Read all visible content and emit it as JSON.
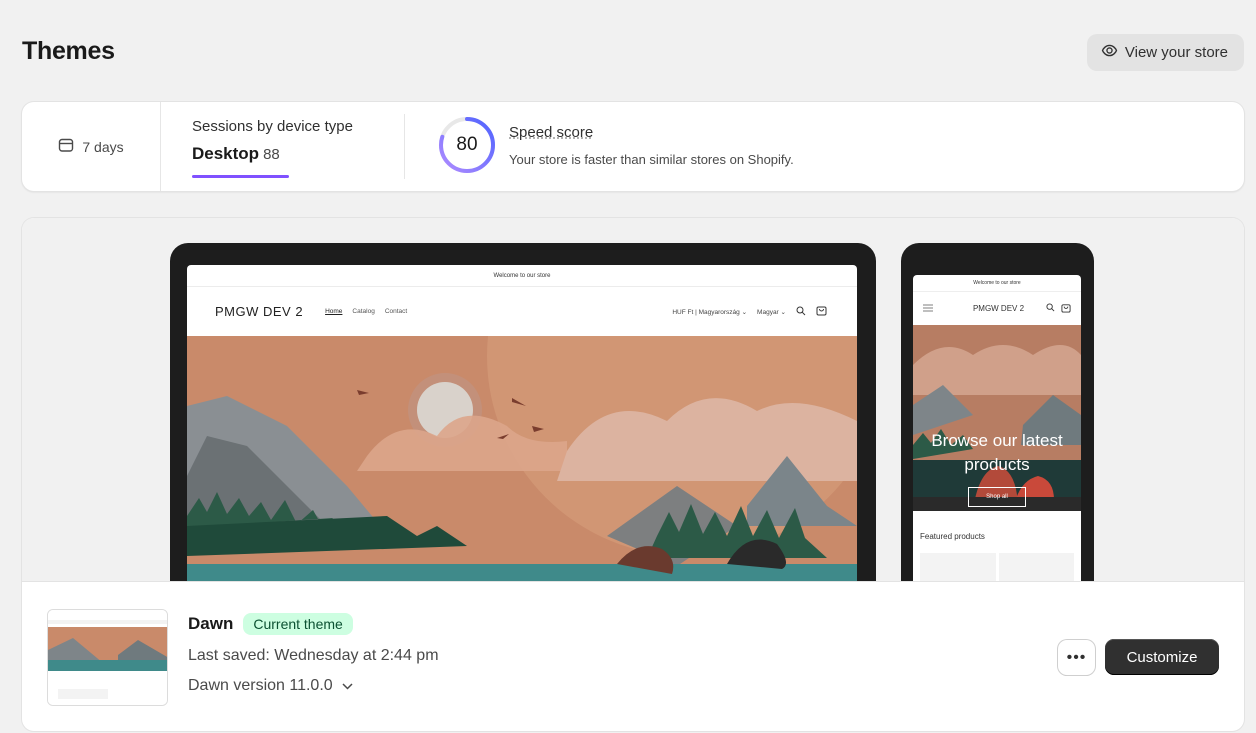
{
  "page": {
    "title": "Themes"
  },
  "header": {
    "view_store_label": "View your store"
  },
  "stats": {
    "period_label": "7 days",
    "sessions_label": "Sessions by device type",
    "device_label": "Desktop",
    "device_value": "88",
    "speed_score": "80",
    "speed_score_fraction": 0.8,
    "speed_title": "Speed score",
    "speed_description": "Your store is faster than similar stores on Shopify."
  },
  "preview": {
    "desktop": {
      "announcement": "Welcome to our store",
      "brand": "PMGW DEV 2",
      "nav": [
        "Home",
        "Catalog",
        "Contact"
      ],
      "currency": "HUF Ft | Magyarország",
      "language": "Magyar"
    },
    "mobile": {
      "announcement": "Welcome to our store",
      "brand": "PMGW DEV 2",
      "hero_title": "Browse our latest products",
      "hero_button": "Shop all",
      "featured_title": "Featured products"
    }
  },
  "theme": {
    "name": "Dawn",
    "badge": "Current theme",
    "last_saved": "Last saved: Wednesday at 2:44 pm",
    "version": "Dawn version 11.0.0",
    "more_label": "•••",
    "customize_label": "Customize"
  }
}
